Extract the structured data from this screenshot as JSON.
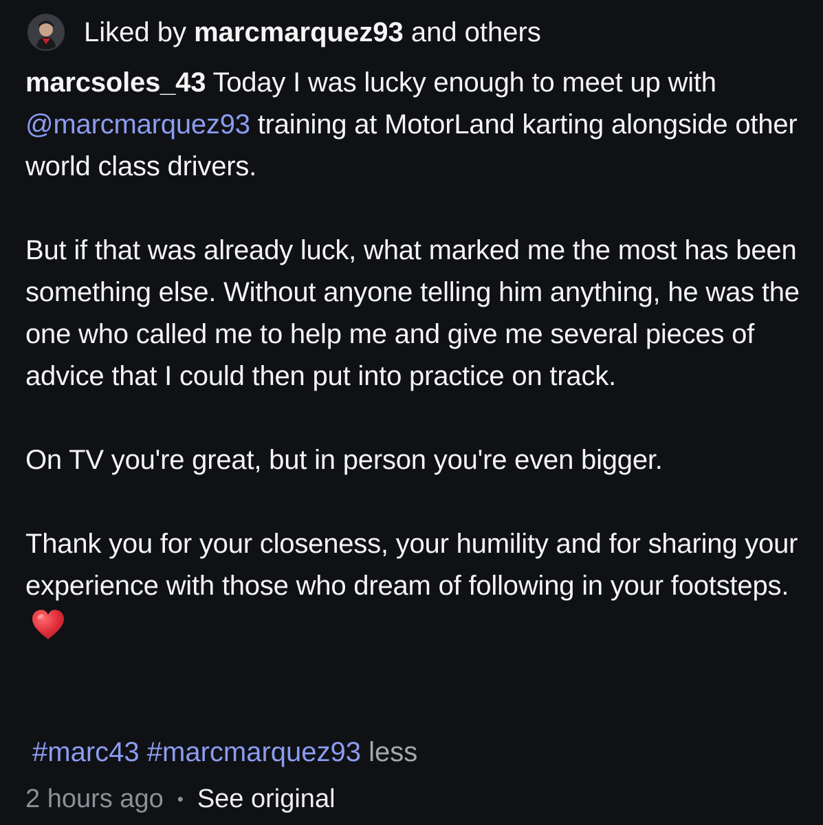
{
  "liked": {
    "prefix": "Liked by ",
    "username": "marcmarquez93",
    "suffix": " and others"
  },
  "caption": {
    "author": "marcsoles_43",
    "p1_before": " Today I was lucky enough to meet up with ",
    "mention": "@marcmarquez93",
    "p1_after": " training at MotorLand karting alongside other world class drivers.",
    "p2": "But if that was already luck, what marked me the most has been something else. Without anyone telling him anything, he was the one who called me to help me and give me several pieces of advice that I could then put into practice on track.",
    "p3": "On TV you're great, but in person you're even bigger.",
    "p4": "Thank you for your closeness, your humility and for sharing your experience with those who dream of following in your footsteps.",
    "emoji": "heart-emoji"
  },
  "hashtags": [
    "#marc43",
    "#marcmarquez93"
  ],
  "less_label": "less",
  "meta": {
    "time": "2 hours ago",
    "separator": "•",
    "see_original": "See original"
  },
  "colors": {
    "background": "#0f1115",
    "text": "#f5f5f5",
    "link": "#8c9cf0",
    "muted": "#8e9096",
    "heart": "#e0303b"
  }
}
